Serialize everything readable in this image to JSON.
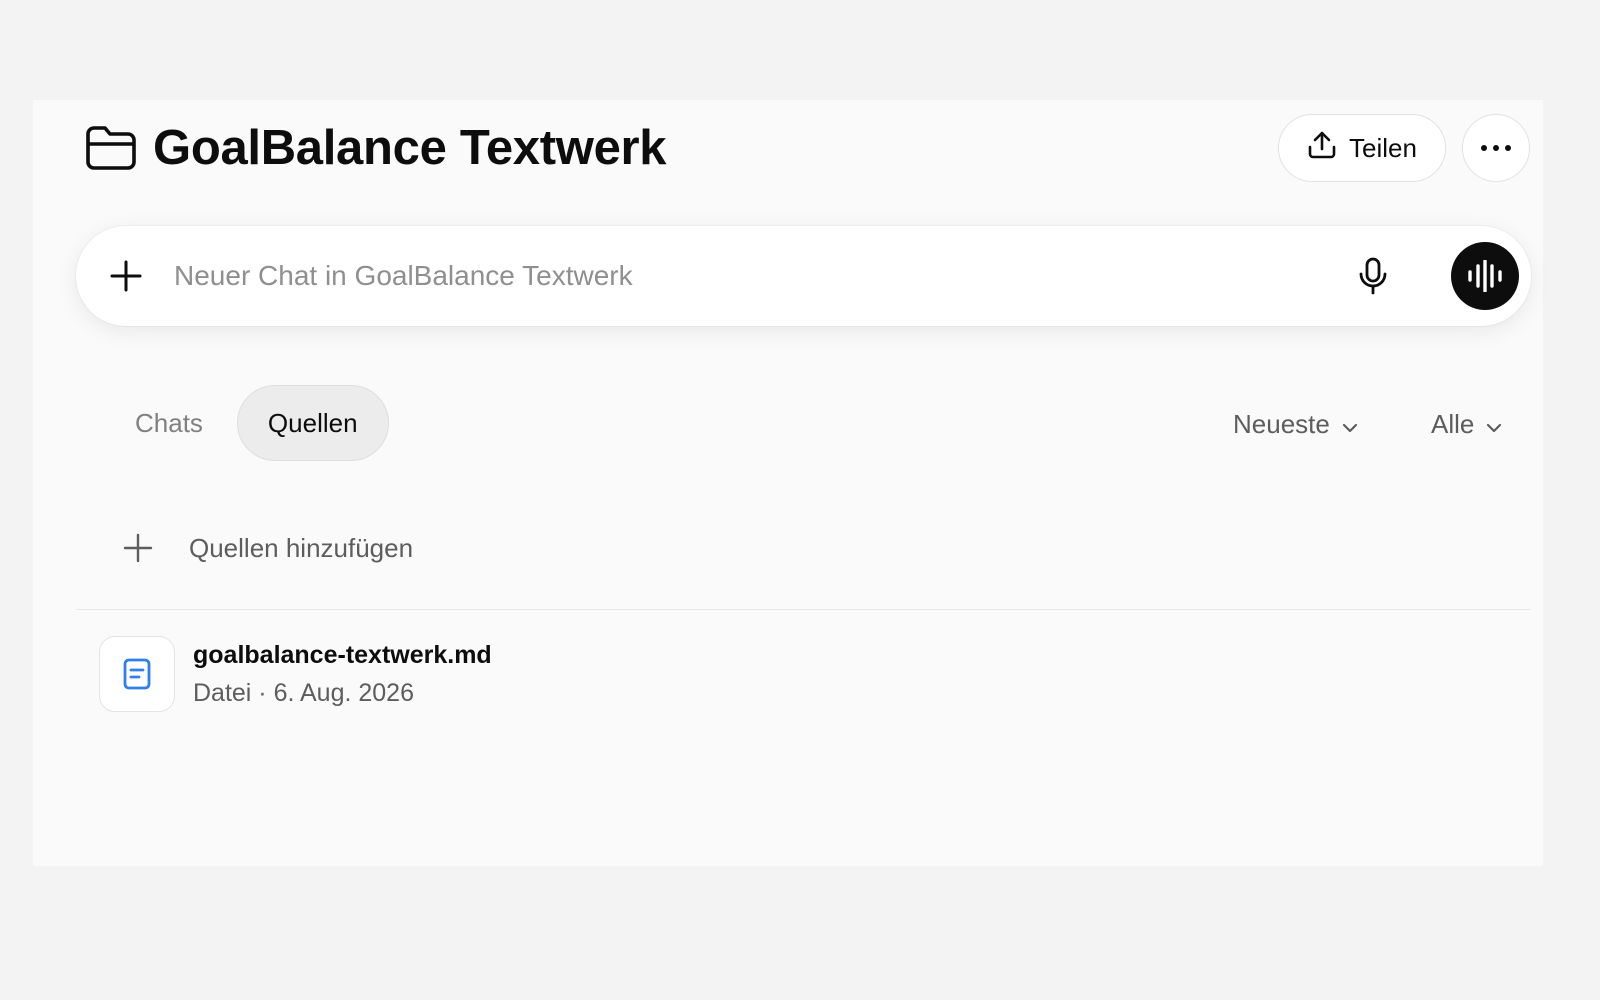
{
  "project": {
    "title": "GoalBalance Textwerk",
    "folder_icon": "folder-icon"
  },
  "header": {
    "share_label": "Teilen",
    "share_icon": "upload-icon",
    "more_icon": "ellipsis-icon"
  },
  "composer": {
    "placeholder": "Neuer Chat in GoalBalance Textwerk",
    "value": "",
    "add_icon": "plus-icon",
    "mic_icon": "microphone-icon",
    "voice_icon": "voice-waveform-icon"
  },
  "tabs": [
    {
      "label": "Chats",
      "active": false
    },
    {
      "label": "Quellen",
      "active": true
    }
  ],
  "controls": {
    "sort_label": "Neueste",
    "filter_label": "Alle",
    "chevron_icon": "chevron-down-icon"
  },
  "sources": {
    "add_label": "Quellen hinzufügen",
    "items": [
      {
        "name": "goalbalance-textwerk.md",
        "meta": "Datei · 6. Aug. 2026",
        "icon": "document-icon"
      }
    ]
  },
  "colors": {
    "page_background": "#f3f3f3",
    "panel_background": "#fafafa",
    "voice_button": "#0d0d0d",
    "file_icon_accent": "#2f80ed",
    "muted_text": "#5d5d5d"
  }
}
